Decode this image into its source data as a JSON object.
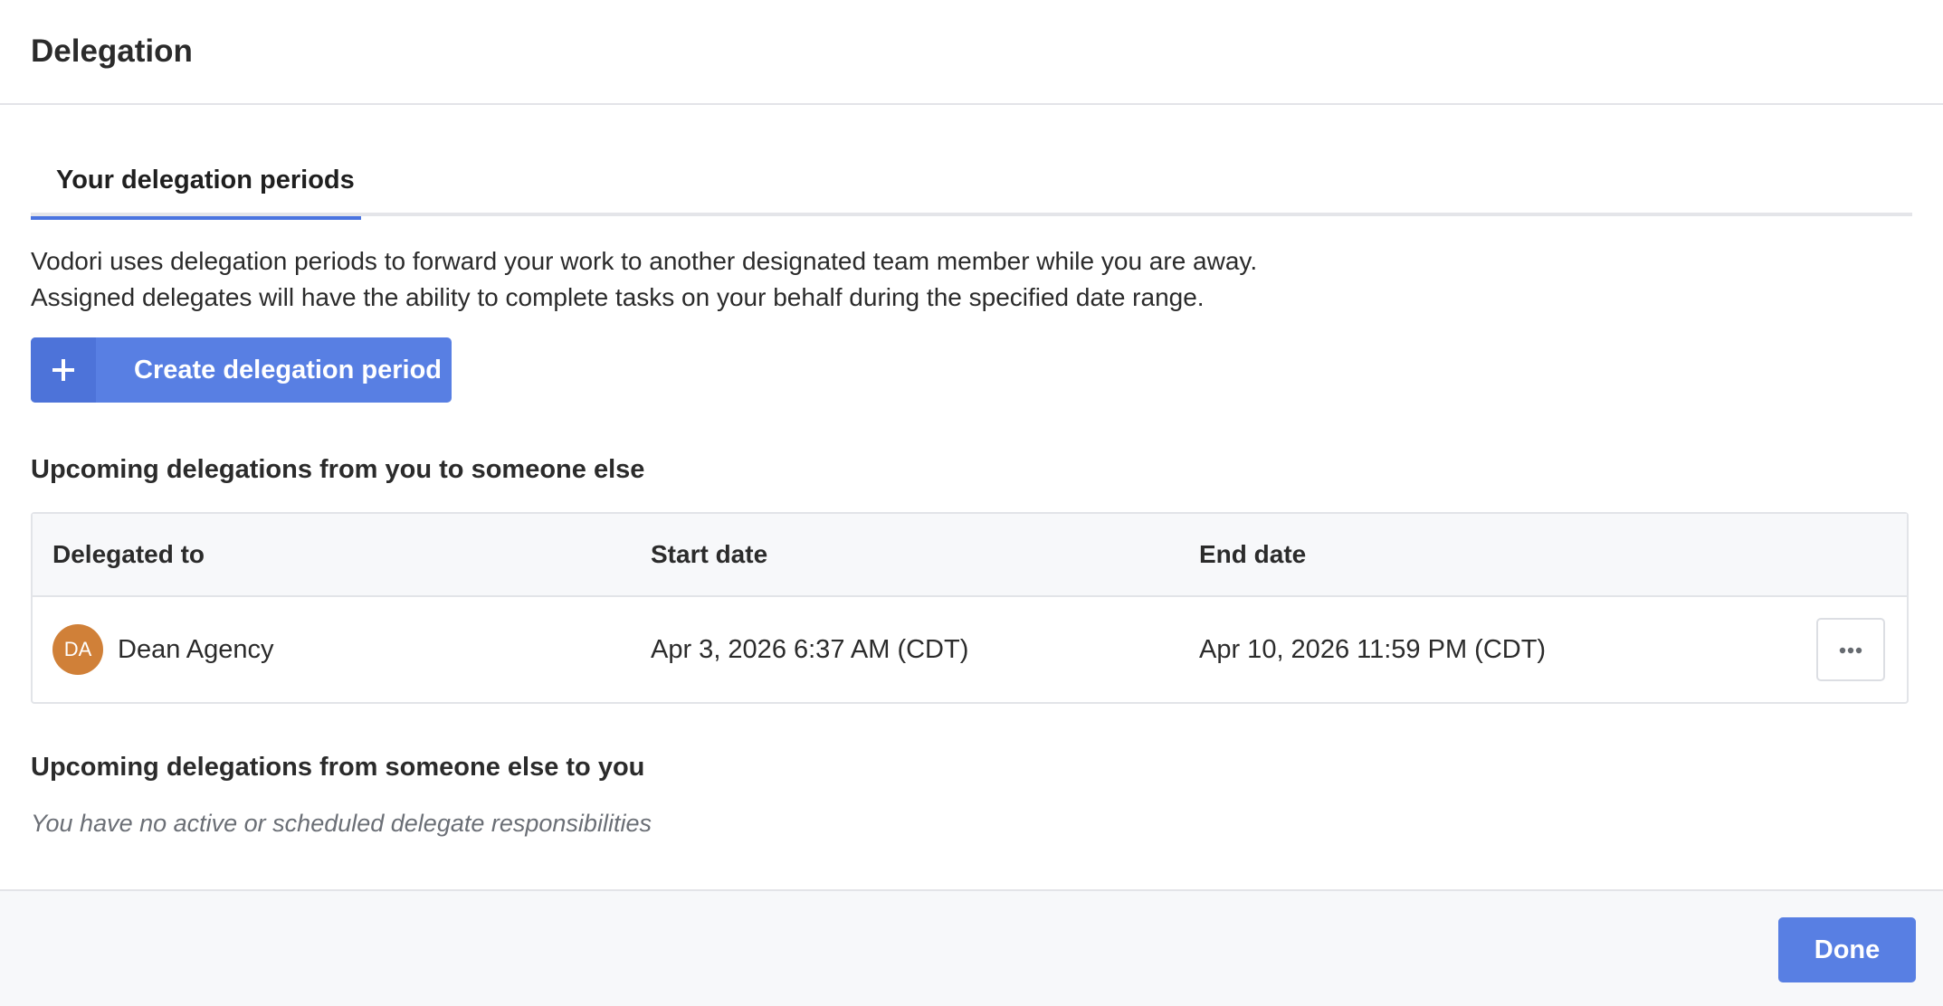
{
  "dialog": {
    "title": "Delegation"
  },
  "tabs": [
    {
      "label": "Your delegation periods",
      "active": true
    }
  ],
  "description": {
    "line1": "Vodori uses delegation periods to forward your work to another designated team member while you are away.",
    "line2": "Assigned delegates will have the ability to complete tasks on your behalf during the specified date range."
  },
  "create_button": {
    "icon": "plus-icon",
    "label": "Create delegation period"
  },
  "outgoing": {
    "title": "Upcoming delegations from you to someone else",
    "columns": [
      "Delegated to",
      "Start date",
      "End date"
    ],
    "rows": [
      {
        "avatar_initials": "DA",
        "avatar_color": "#d08038",
        "name": "Dean Agency",
        "start": "Apr 3, 2026 6:37 AM (CDT)",
        "end": "Apr 10, 2026 11:59 PM (CDT)",
        "actions_icon": "more-horizontal-icon"
      }
    ]
  },
  "incoming": {
    "title": "Upcoming delegations from someone else to you",
    "empty_text": "You have no active or scheduled delegate responsibilities"
  },
  "footer": {
    "done_label": "Done"
  },
  "colors": {
    "accent": "#587fe3",
    "tab_underline": "#4a74e0",
    "avatar": "#d08038"
  }
}
